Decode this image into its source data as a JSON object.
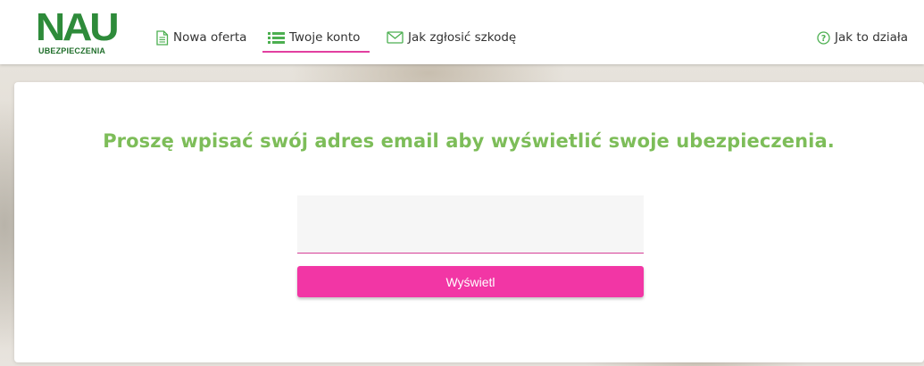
{
  "brand": {
    "logo_mark": "NAU",
    "logo_text": "UBEZPIECZENIA",
    "green": "#2e8b3a"
  },
  "nav": {
    "items": [
      {
        "label": "Nowa oferta",
        "icon": "document-icon"
      },
      {
        "label": "Twoje konto",
        "icon": "list-icon",
        "active": true
      },
      {
        "label": "Jak zgłosić szkodę",
        "icon": "envelope-icon"
      }
    ],
    "help": {
      "label": "Jak to działa",
      "icon": "question-circle-icon"
    }
  },
  "main": {
    "heading": "Proszę wpisać swój adres email aby wyświetlić swoje ubezpieczenia.",
    "email_value": "",
    "email_placeholder": "",
    "submit_label": "Wyświetl"
  },
  "colors": {
    "accent_pink": "#f236a5",
    "heading_green": "#7dbd59",
    "nav_icon_green": "#4caf50"
  }
}
